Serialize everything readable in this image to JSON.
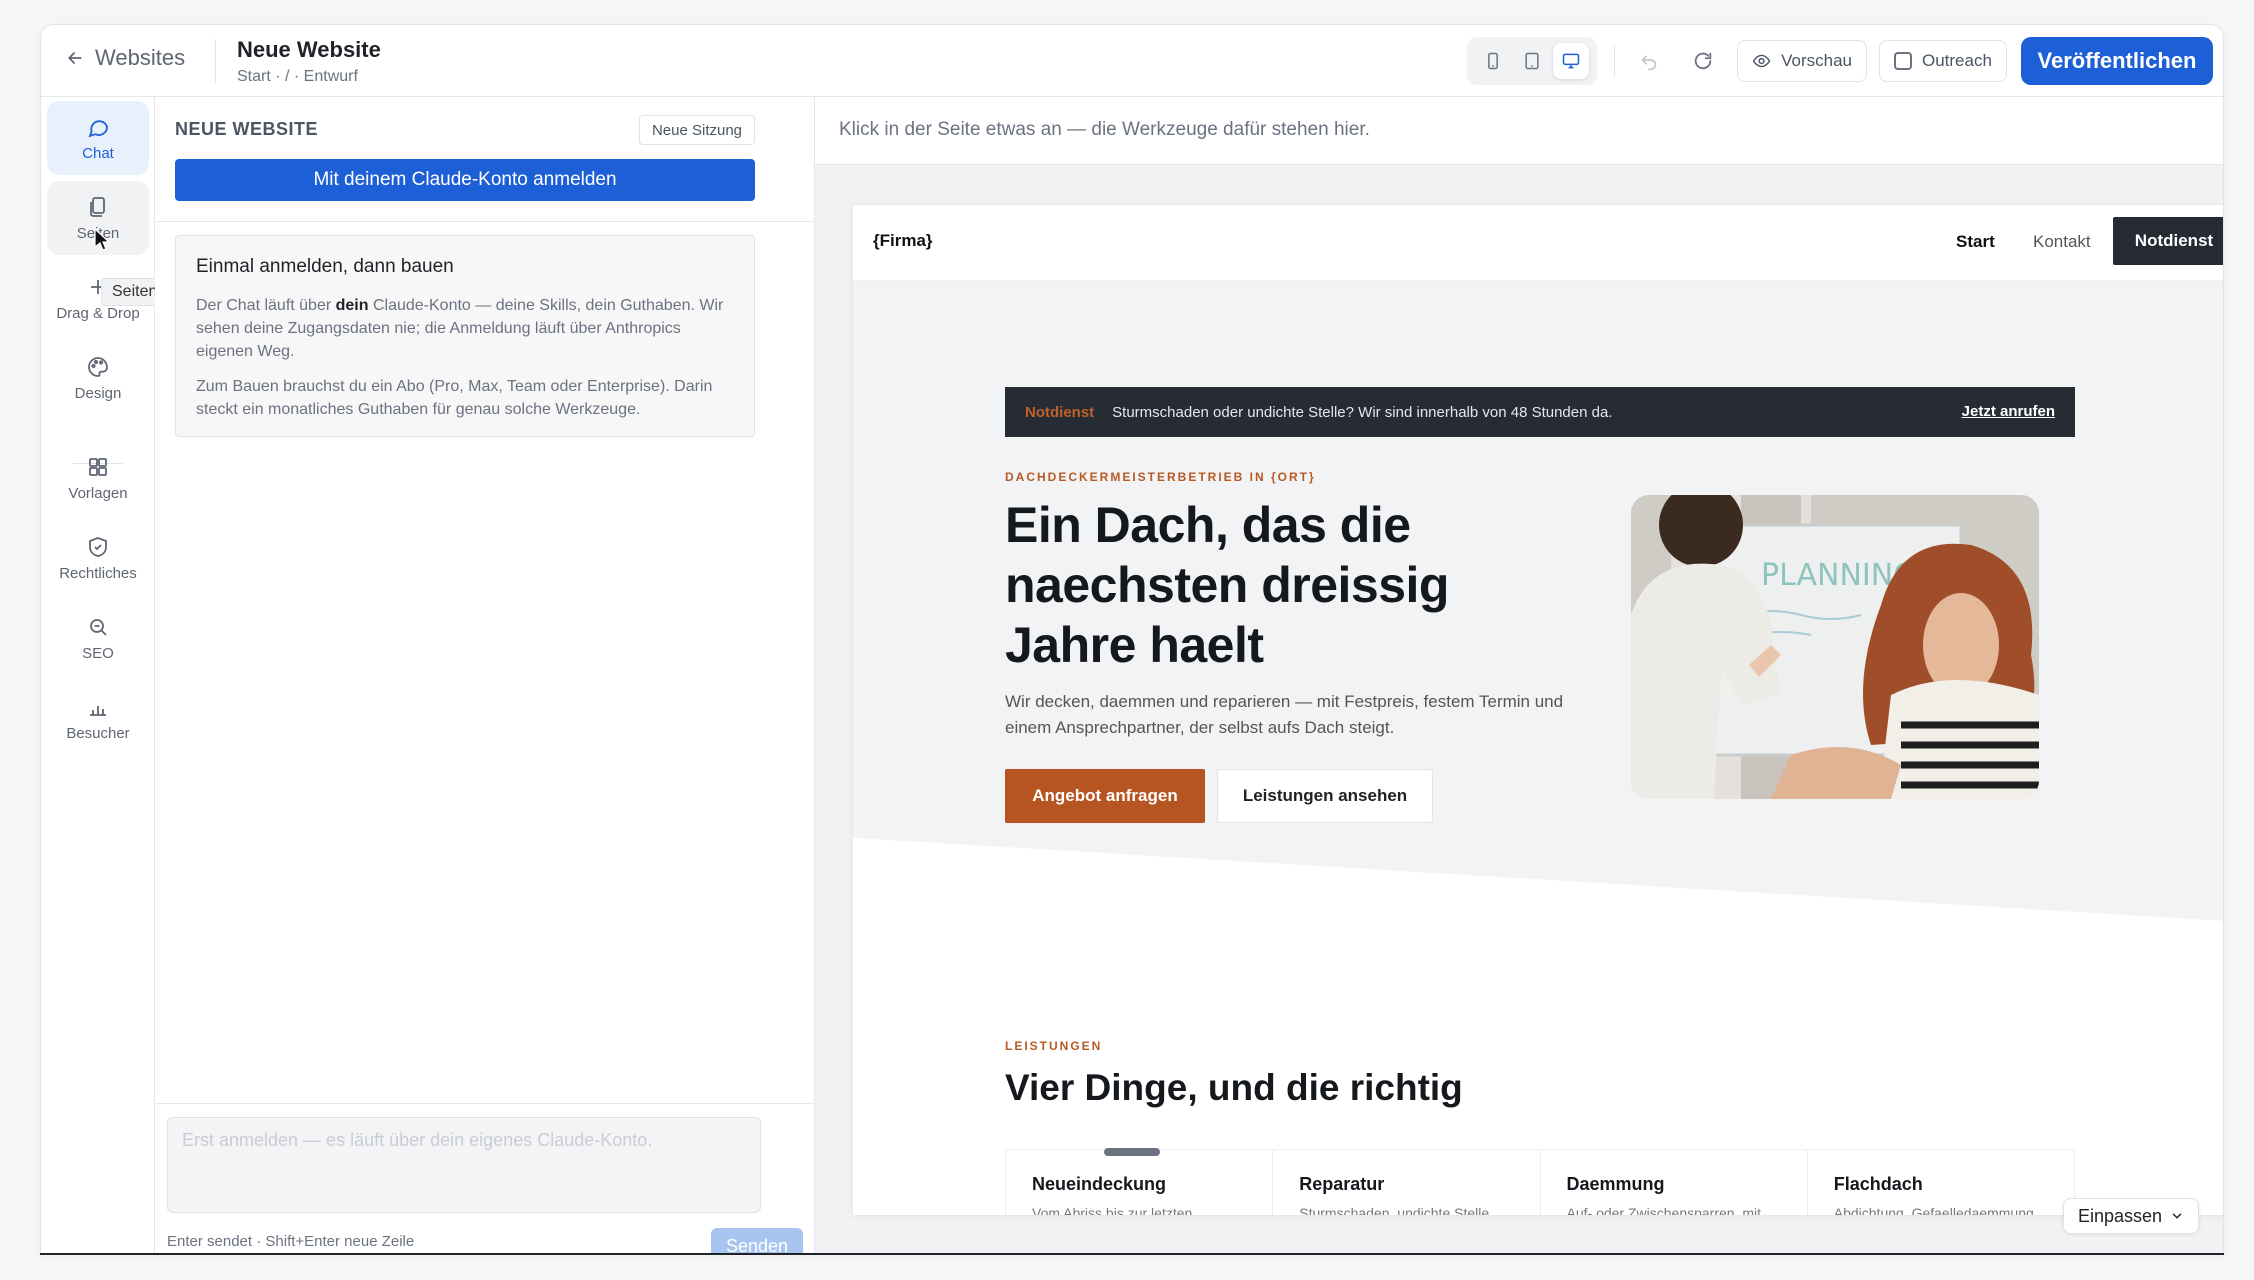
{
  "topbar": {
    "back_label": "Websites",
    "site_title": "Neue Website",
    "site_breadcrumb": "Start · / · Entwurf",
    "preview_label": "Vorschau",
    "outreach_label": "Outreach",
    "publish_label": "Veröffentlichen",
    "active_device": "desktop"
  },
  "rail": {
    "items": [
      {
        "label": "Chat",
        "icon": "chat-bubble-icon"
      },
      {
        "label": "Seiten",
        "icon": "pages-icon"
      },
      {
        "label": "Drag & Drop",
        "icon": "plus-icon"
      },
      {
        "label": "Design",
        "icon": "palette-icon"
      },
      {
        "label": "Vorlagen",
        "icon": "grid-icon"
      },
      {
        "label": "Rechtliches",
        "icon": "shield-check-icon"
      },
      {
        "label": "SEO",
        "icon": "search-icon"
      },
      {
        "label": "Besucher",
        "icon": "bar-chart-icon"
      }
    ],
    "tooltip": "Seiten"
  },
  "chat": {
    "title": "NEUE WEBSITE",
    "new_session_label": "Neue Sitzung",
    "login_label": "Mit deinem Claude-Konto anmelden",
    "card_title": "Einmal anmelden, dann bauen",
    "card_p1_a": "Der Chat läuft über ",
    "card_p1_b": "dein",
    "card_p1_c": " Claude-Konto — deine Skills, dein Guthaben. Wir sehen deine Zugangsdaten nie; die Anmeldung läuft über Anthropics eigenen Weg.",
    "card_p2": "Zum Bauen brauchst du ein Abo (Pro, Max, Team oder Enterprise). Darin steckt ein monatliches Guthaben für genau solche Werkzeuge.",
    "composer_placeholder": "Erst anmelden — es läuft über dein eigenes Claude-Konto.",
    "hint": "Enter sendet · Shift+Enter neue Zeile",
    "send_label": "Senden"
  },
  "canvas": {
    "hint": "Klick in der Seite etwas an — die Werkzeuge dafür stehen hier.",
    "fit_label": "Einpassen"
  },
  "site": {
    "brand": "{Firma}",
    "nav_start": "Start",
    "nav_kontakt": "Kontakt",
    "nav_cta": "Notdienst",
    "banner_tag": "Notdienst",
    "banner_text": "Sturmschaden oder undichte Stelle? Wir sind innerhalb von 48 Stunden da.",
    "banner_call": "Jetzt anrufen",
    "eyebrow": "DACHDECKERMEISTERBETRIEB IN {ORT}",
    "headline": "Ein Dach, das die naechsten dreissig Jahre haelt",
    "lead": "Wir decken, daemmen und reparieren — mit Festpreis, festem Termin und einem Ansprechpartner, der selbst aufs Dach steigt.",
    "btn_primary": "Angebot anfragen",
    "btn_secondary": "Leistungen ansehen",
    "section_eyebrow": "LEISTUNGEN",
    "section_title": "Vier Dinge, und die richtig",
    "services": [
      {
        "title": "Neueindeckung",
        "text": "Vom Abriss bis zur letzten"
      },
      {
        "title": "Reparatur",
        "text": "Sturmschaden, undichte Stelle"
      },
      {
        "title": "Daemmung",
        "text": "Auf- oder Zwischensparren, mit"
      },
      {
        "title": "Flachdach",
        "text": "Abdichtung, Gefaelledaemmung"
      }
    ],
    "image_board_text": "PLANNING"
  },
  "colors": {
    "accent": "#1d5fd6",
    "brand_orange": "#b65522",
    "dark": "#252a33"
  }
}
